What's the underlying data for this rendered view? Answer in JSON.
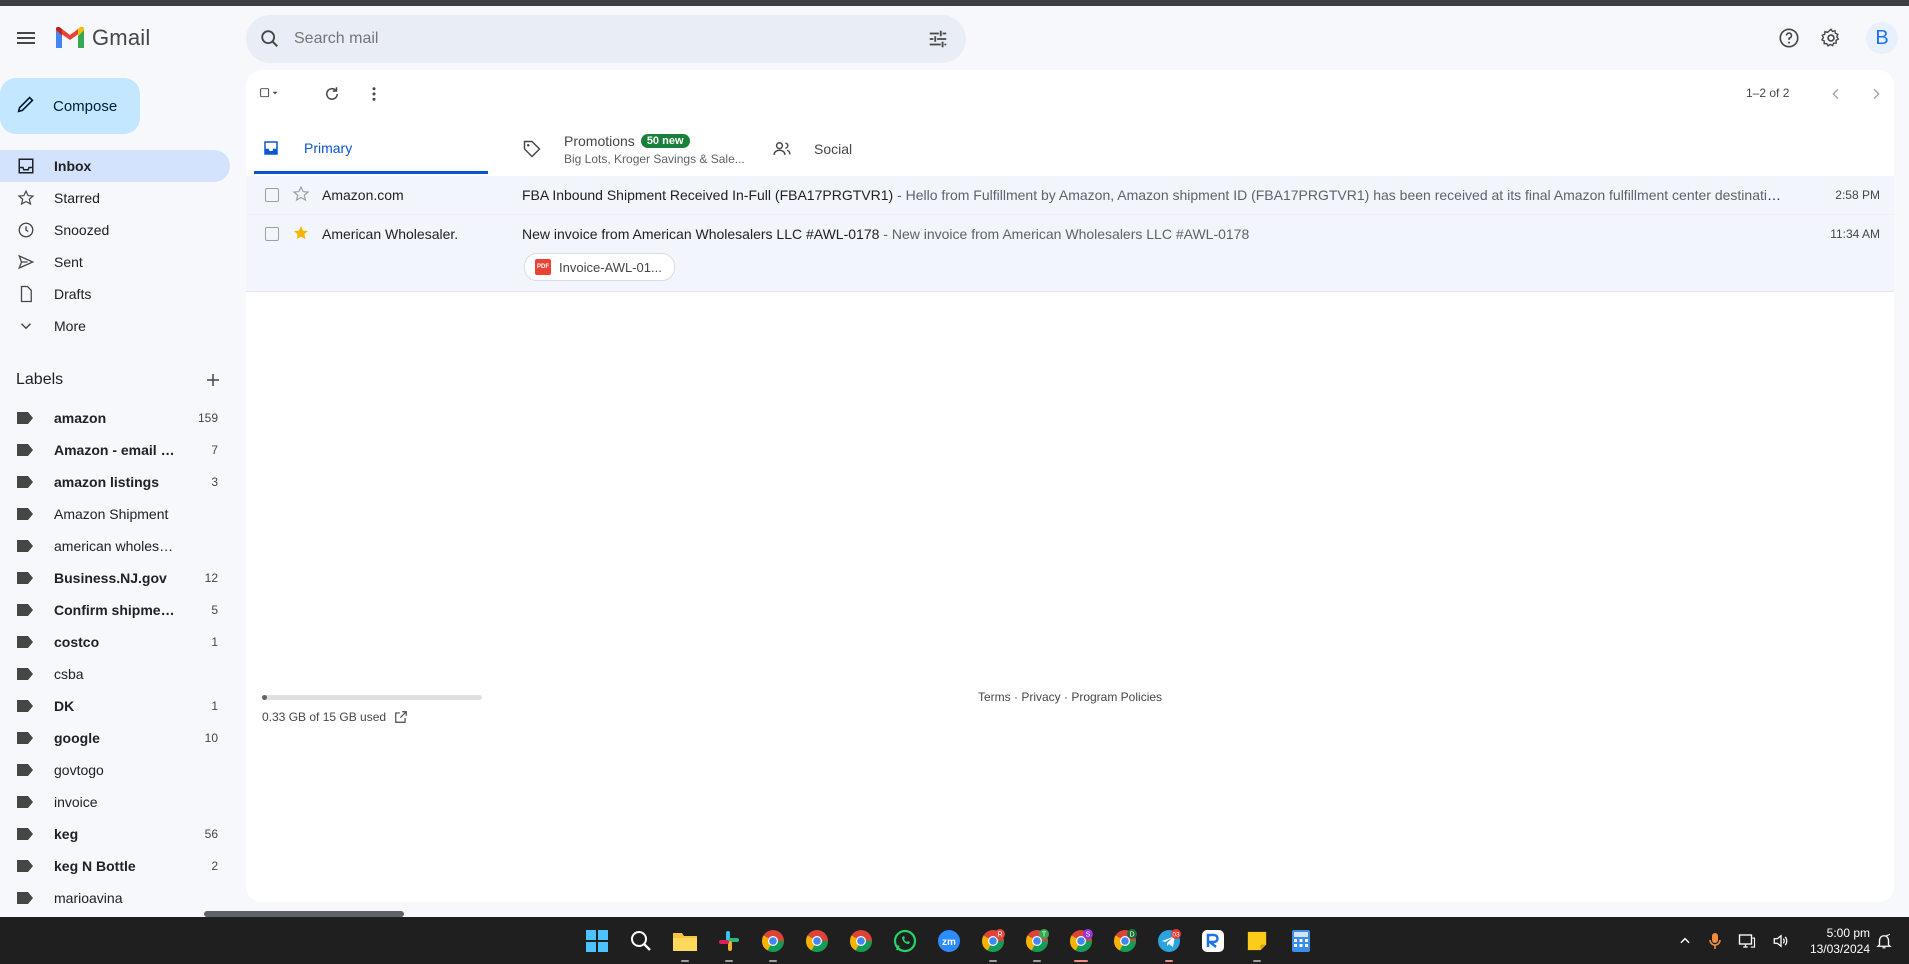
{
  "app": {
    "name": "Gmail"
  },
  "header": {
    "search_placeholder": "Search mail",
    "avatar_initial": "B"
  },
  "sidebar": {
    "compose_label": "Compose",
    "items": [
      {
        "label": "Inbox",
        "icon": "inbox-icon",
        "active": true
      },
      {
        "label": "Starred",
        "icon": "star-icon"
      },
      {
        "label": "Snoozed",
        "icon": "clock-icon"
      },
      {
        "label": "Sent",
        "icon": "send-icon"
      },
      {
        "label": "Drafts",
        "icon": "draft-icon"
      },
      {
        "label": "More",
        "icon": "chevron-down-icon"
      }
    ],
    "labels_title": "Labels",
    "labels": [
      {
        "name": "amazon",
        "count": "159",
        "bold": true
      },
      {
        "name": "Amazon - email to ...",
        "count": "7",
        "bold": true
      },
      {
        "name": "amazon listings",
        "count": "3",
        "bold": true
      },
      {
        "name": "Amazon Shipment",
        "count": "",
        "bold": false
      },
      {
        "name": "american wholesaler",
        "count": "",
        "bold": false
      },
      {
        "name": "Business.NJ.gov",
        "count": "12",
        "bold": true
      },
      {
        "name": "Confirm shipment ...",
        "count": "5",
        "bold": true
      },
      {
        "name": "costco",
        "count": "1",
        "bold": true
      },
      {
        "name": "csba",
        "count": "",
        "bold": false
      },
      {
        "name": "DK",
        "count": "1",
        "bold": true
      },
      {
        "name": "google",
        "count": "10",
        "bold": true
      },
      {
        "name": "govtogo",
        "count": "",
        "bold": false
      },
      {
        "name": "invoice",
        "count": "",
        "bold": false
      },
      {
        "name": "keg",
        "count": "56",
        "bold": true
      },
      {
        "name": "keg N Bottle",
        "count": "2",
        "bold": true
      },
      {
        "name": "marioavina",
        "count": "",
        "bold": false
      }
    ]
  },
  "toolbar": {
    "pager": "1–2 of 2"
  },
  "tabs": {
    "primary": "Primary",
    "promotions": "Promotions",
    "promotions_badge": "50 new",
    "promotions_sub": "Big Lots, Kroger Savings & Sale...",
    "social": "Social"
  },
  "emails": [
    {
      "sender": "Amazon.com",
      "subject": "FBA Inbound Shipment Received In-Full (FBA17PRGTVR1)",
      "snippet": " - Hello from Fulfillment by Amazon, Amazon shipment ID (FBA17PRGTVR1) has been received at its final Amazon fulfillment center destination...",
      "time": "2:58 PM",
      "starred": false
    },
    {
      "sender": "American Wholesaler.",
      "subject": "New invoice from American Wholesalers LLC #AWL-0178",
      "snippet": " - New invoice from American Wholesalers LLC #AWL-0178",
      "time": "11:34 AM",
      "starred": true,
      "attachment": "Invoice-AWL-01...",
      "attachment_type": "PDF"
    }
  ],
  "storage": {
    "text": "0.33 GB of 15 GB used",
    "fraction": 0.022
  },
  "footer": {
    "links": "Terms · Privacy · Program Policies"
  },
  "taskbar": {
    "time": "5:00 pm",
    "date": "13/03/2024",
    "badges": {
      "chrome_r": "R",
      "chrome_t": "T",
      "chrome_s": "S",
      "chrome_d": "D",
      "telegram": "03"
    }
  },
  "colors": {
    "accent": "#0b57d0",
    "compose_bg": "#c2e7ff",
    "active_nav": "#d3e3fd",
    "star": "#f4b400",
    "promo_badge": "#188038"
  }
}
